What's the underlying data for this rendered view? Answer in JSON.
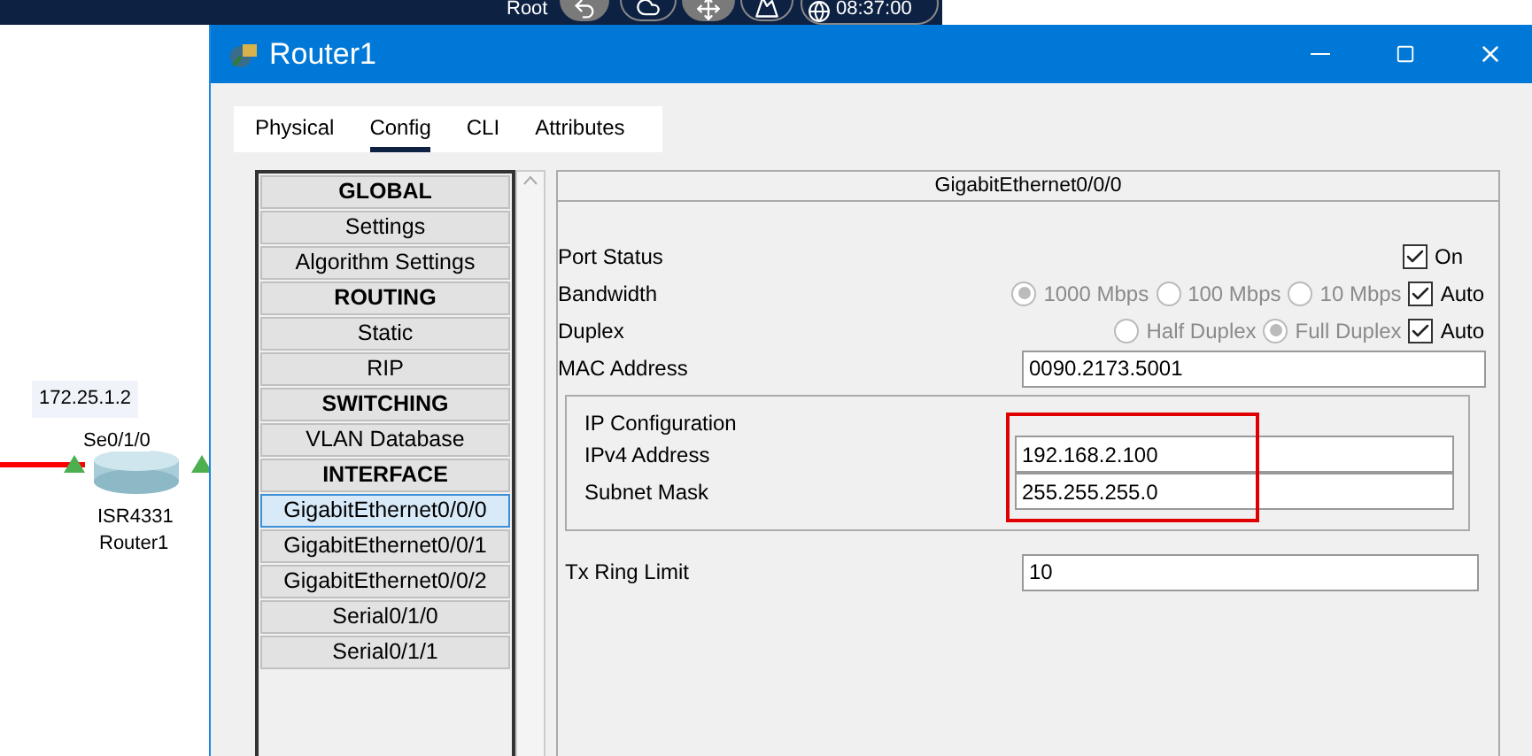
{
  "top_bar": {
    "workspace": "Root",
    "time": "08:37:00"
  },
  "canvas": {
    "ip_label": "172.25.1.2",
    "port_label": "Se0/1/0",
    "device_model": "ISR4331",
    "device_name": "Router1"
  },
  "window": {
    "title": "Router1"
  },
  "tabs": [
    {
      "label": "Physical",
      "selected": false
    },
    {
      "label": "Config",
      "selected": true
    },
    {
      "label": "CLI",
      "selected": false
    },
    {
      "label": "Attributes",
      "selected": false
    }
  ],
  "sidebar": {
    "items": [
      {
        "label": "GLOBAL",
        "kind": "header",
        "selected": false
      },
      {
        "label": "Settings",
        "kind": "item",
        "selected": false
      },
      {
        "label": "Algorithm Settings",
        "kind": "item",
        "selected": false
      },
      {
        "label": "ROUTING",
        "kind": "header",
        "selected": false
      },
      {
        "label": "Static",
        "kind": "item",
        "selected": false
      },
      {
        "label": "RIP",
        "kind": "item",
        "selected": false
      },
      {
        "label": "SWITCHING",
        "kind": "header",
        "selected": false
      },
      {
        "label": "VLAN Database",
        "kind": "item",
        "selected": false
      },
      {
        "label": "INTERFACE",
        "kind": "header",
        "selected": false
      },
      {
        "label": "GigabitEthernet0/0/0",
        "kind": "item",
        "selected": true
      },
      {
        "label": "GigabitEthernet0/0/1",
        "kind": "item",
        "selected": false
      },
      {
        "label": "GigabitEthernet0/0/2",
        "kind": "item",
        "selected": false
      },
      {
        "label": "Serial0/1/0",
        "kind": "item",
        "selected": false
      },
      {
        "label": "Serial0/1/1",
        "kind": "item",
        "selected": false
      }
    ]
  },
  "panel": {
    "title": "GigabitEthernet0/0/0",
    "port_status": {
      "label": "Port Status",
      "checkbox_label": "On",
      "checked": true
    },
    "bandwidth": {
      "label": "Bandwidth",
      "disabled": true,
      "options": [
        {
          "label": "1000 Mbps",
          "selected": true
        },
        {
          "label": "100 Mbps",
          "selected": false
        },
        {
          "label": "10 Mbps",
          "selected": false
        }
      ],
      "auto": {
        "label": "Auto",
        "checked": true
      }
    },
    "duplex": {
      "label": "Duplex",
      "disabled": true,
      "options": [
        {
          "label": "Half Duplex",
          "selected": false
        },
        {
          "label": "Full Duplex",
          "selected": true
        }
      ],
      "auto": {
        "label": "Auto",
        "checked": true
      }
    },
    "mac": {
      "label": "MAC Address",
      "value": "0090.2173.5001"
    },
    "ip_config": {
      "title": "IP Configuration",
      "fields": [
        {
          "label": "IPv4 Address",
          "value": "192.168.2.100"
        },
        {
          "label": "Subnet Mask",
          "value": "255.255.255.0"
        }
      ]
    },
    "tx_ring": {
      "label": "Tx Ring Limit",
      "value": "10"
    }
  }
}
